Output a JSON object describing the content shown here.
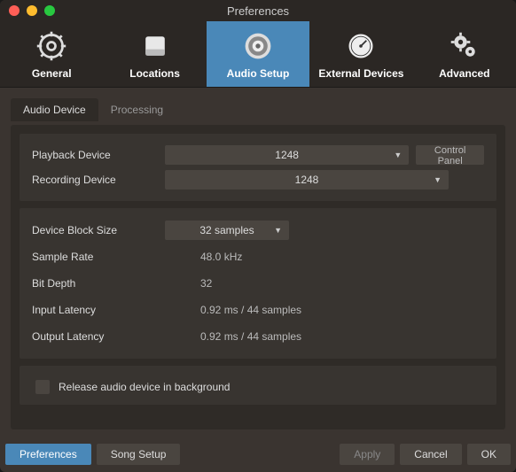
{
  "window": {
    "title": "Preferences"
  },
  "toolbar": {
    "items": [
      {
        "label": "General"
      },
      {
        "label": "Locations"
      },
      {
        "label": "Audio Setup"
      },
      {
        "label": "External Devices"
      },
      {
        "label": "Advanced"
      }
    ]
  },
  "tabs": {
    "audio_device": "Audio Device",
    "processing": "Processing"
  },
  "playback": {
    "label": "Playback Device",
    "value": "1248",
    "control_panel": "Control Panel"
  },
  "recording": {
    "label": "Recording Device",
    "value": "1248"
  },
  "block_size": {
    "label": "Device Block Size",
    "value": "32 samples"
  },
  "sample_rate": {
    "label": "Sample Rate",
    "value": "48.0 kHz"
  },
  "bit_depth": {
    "label": "Bit Depth",
    "value": "32"
  },
  "input_latency": {
    "label": "Input Latency",
    "value": "0.92 ms / 44 samples"
  },
  "output_latency": {
    "label": "Output Latency",
    "value": "0.92 ms / 44 samples"
  },
  "release_bg": {
    "label": "Release audio device in background"
  },
  "footer": {
    "preferences": "Preferences",
    "song_setup": "Song Setup",
    "apply": "Apply",
    "cancel": "Cancel",
    "ok": "OK"
  }
}
